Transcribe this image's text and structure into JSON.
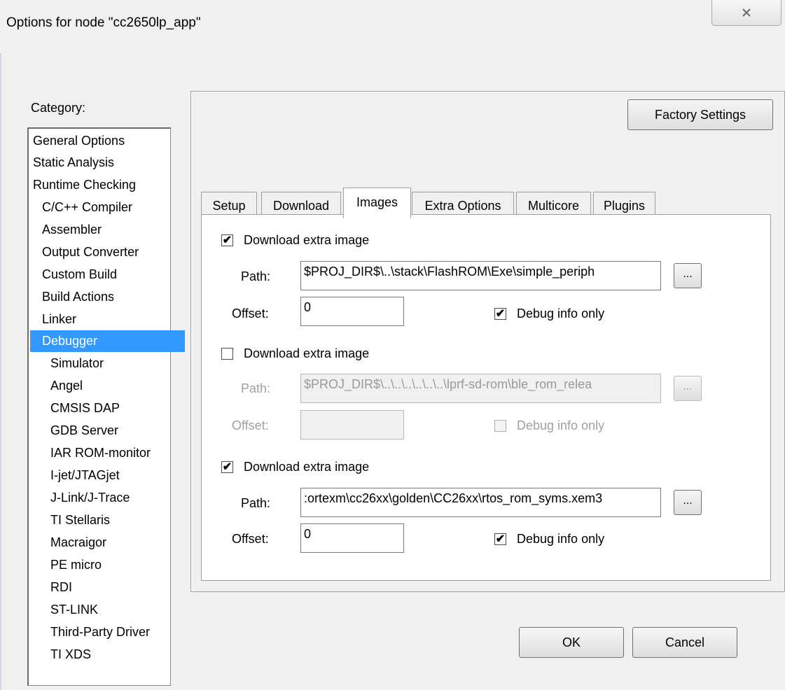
{
  "window": {
    "title": "Options for node \"cc2650lp_app\"",
    "close_glyph": "☒"
  },
  "category": {
    "label": "Category:",
    "items": [
      "General Options",
      "Static Analysis",
      "Runtime Checking",
      "C/C++ Compiler",
      "Assembler",
      "Output Converter",
      "Custom Build",
      "Build Actions",
      "Linker",
      "Debugger",
      "Simulator",
      "Angel",
      "CMSIS DAP",
      "GDB Server",
      "IAR ROM-monitor",
      "I-jet/JTAGjet",
      "J-Link/J-Trace",
      "TI Stellaris",
      "Macraigor",
      "PE micro",
      "RDI",
      "ST-LINK",
      "Third-Party Driver",
      "TI XDS"
    ],
    "selected": "Debugger"
  },
  "factory_settings_label": "Factory Settings",
  "tabs": [
    "Setup",
    "Download",
    "Images",
    "Extra Options",
    "Multicore",
    "Plugins"
  ],
  "active_tab": "Images",
  "images": [
    {
      "checkbox_label": "Download extra image",
      "checked": true,
      "enabled": true,
      "path_label": "Path:",
      "path_value": "$PROJ_DIR$\\..\\stack\\FlashROM\\Exe\\simple_periph",
      "offset_label": "Offset:",
      "offset_value": "0",
      "debug_label": "Debug info only",
      "debug_checked": true,
      "browse_label": "..."
    },
    {
      "checkbox_label": "Download extra image",
      "checked": false,
      "enabled": false,
      "path_label": "Path:",
      "path_value": "$PROJ_DIR$\\..\\..\\..\\..\\..\\..\\lprf-sd-rom\\ble_rom_relea",
      "offset_label": "Offset:",
      "offset_value": "",
      "debug_label": "Debug info only",
      "debug_checked": false,
      "browse_label": "..."
    },
    {
      "checkbox_label": "Download extra image",
      "checked": true,
      "enabled": true,
      "path_label": "Path:",
      "path_value": ":ortexm\\cc26xx\\golden\\CC26xx\\rtos_rom_syms.xem3",
      "offset_label": "Offset:",
      "offset_value": "0",
      "debug_label": "Debug info only",
      "debug_checked": true,
      "browse_label": "..."
    }
  ],
  "buttons": {
    "ok": "OK",
    "cancel": "Cancel"
  },
  "check_glyph": "✔"
}
